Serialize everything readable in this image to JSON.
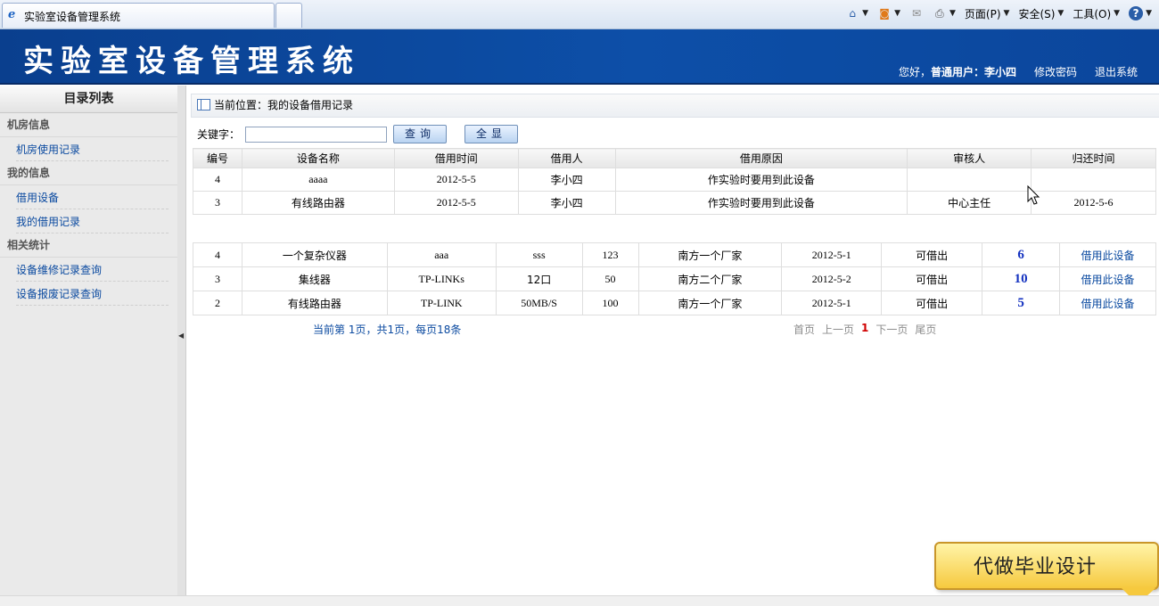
{
  "browser": {
    "tab_title": "实验室设备管理系统",
    "menu_page": "页面(P)",
    "menu_safety": "安全(S)",
    "menu_tools": "工具(O)",
    "help_glyph": "?"
  },
  "header": {
    "logo": "实验室设备管理系统",
    "greeting": "您好，",
    "user_label": "普通用户：李小四",
    "change_password": "修改密码",
    "logout": "退出系统"
  },
  "sidebar": {
    "title": "目录列表",
    "groups": [
      {
        "label": "机房信息",
        "items": [
          "机房使用记录"
        ]
      },
      {
        "label": "我的信息",
        "items": [
          "借用设备",
          "我的借用记录"
        ]
      },
      {
        "label": "相关统计",
        "items": [
          "设备维修记录查询",
          "设备报废记录查询"
        ]
      }
    ]
  },
  "breadcrumb": "当前位置：我的设备借用记录",
  "search": {
    "label": "关键字：",
    "value": "",
    "query_button": "查询",
    "show_all_button": "全显"
  },
  "borrow_table": {
    "headers": [
      "编号",
      "设备名称",
      "借用时间",
      "借用人",
      "借用原因",
      "审核人",
      "归还时间"
    ],
    "rows": [
      [
        "4",
        "aaaa",
        "2012-5-5",
        "李小四",
        "作实验时要用到此设备",
        "",
        ""
      ],
      [
        "3",
        "有线路由器",
        "2012-5-5",
        "李小四",
        "作实验时要用到此设备",
        "中心主任",
        "2012-5-6"
      ]
    ]
  },
  "device_table": {
    "rows": [
      [
        "4",
        "一个复杂仪器",
        "aaa",
        "sss",
        "123",
        "南方一个厂家",
        "2012-5-1",
        "可借出",
        "6",
        "借用此设备"
      ],
      [
        "3",
        "集线器",
        "TP-LINKs",
        "12口",
        "50",
        "南方二个厂家",
        "2012-5-2",
        "可借出",
        "10",
        "借用此设备"
      ],
      [
        "2",
        "有线路由器",
        "TP-LINK",
        "50MB/S",
        "100",
        "南方一个厂家",
        "2012-5-1",
        "可借出",
        "5",
        "借用此设备"
      ]
    ]
  },
  "pager": {
    "summary": "当前第 1页，共1页，每页18条",
    "first": "首页",
    "prev": "上一页",
    "current": "1",
    "next": "下一页",
    "last": "尾页"
  },
  "ad": {
    "text": "代做毕业设计"
  },
  "colors": {
    "header_blue": "#0d4fa8",
    "link_blue": "#0b4aa0",
    "count_blue": "#1432c0",
    "current_page_red": "#d00000"
  }
}
